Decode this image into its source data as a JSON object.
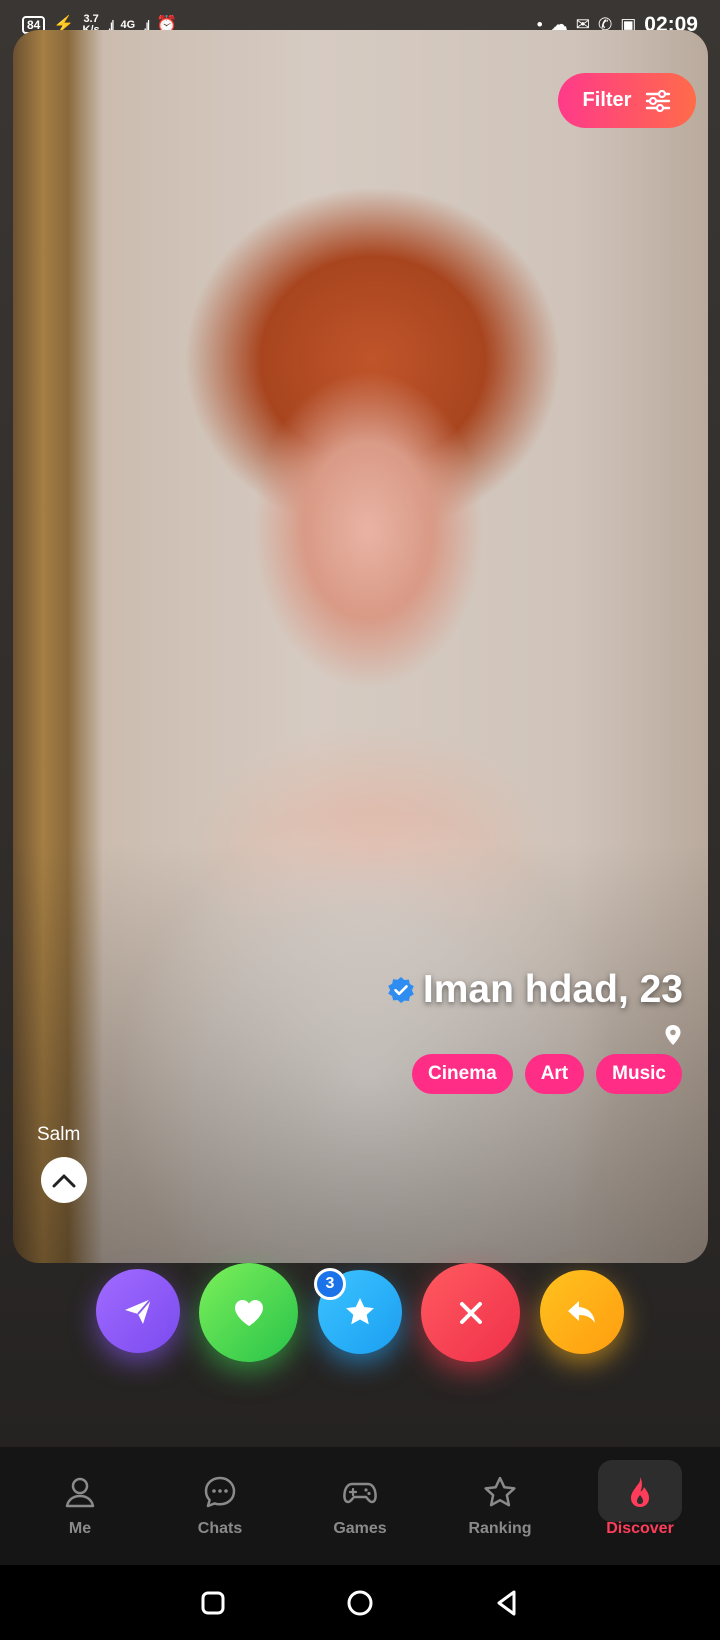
{
  "status_bar": {
    "battery": "84",
    "speed": "3.7",
    "speed_unit": "K/s",
    "network": "4G",
    "time": "02:09"
  },
  "filter": {
    "label": "Filter"
  },
  "profile": {
    "name_age": "Iman hdad, 23",
    "tags": [
      "Cinema",
      "Art",
      "Music"
    ],
    "bio": "Salm"
  },
  "actions": {
    "star_count": "3"
  },
  "nav": {
    "items": [
      {
        "label": "Me",
        "icon": "user-icon"
      },
      {
        "label": "Chats",
        "icon": "chat-icon"
      },
      {
        "label": "Games",
        "icon": "gamepad-icon"
      },
      {
        "label": "Ranking",
        "icon": "star-icon"
      },
      {
        "label": "Discover",
        "icon": "flame-icon"
      }
    ]
  },
  "colors": {
    "accent": "#ff3d5a",
    "tag": "#ff2d86",
    "filter_start": "#ff3a8a",
    "filter_end": "#ff6b4a"
  }
}
